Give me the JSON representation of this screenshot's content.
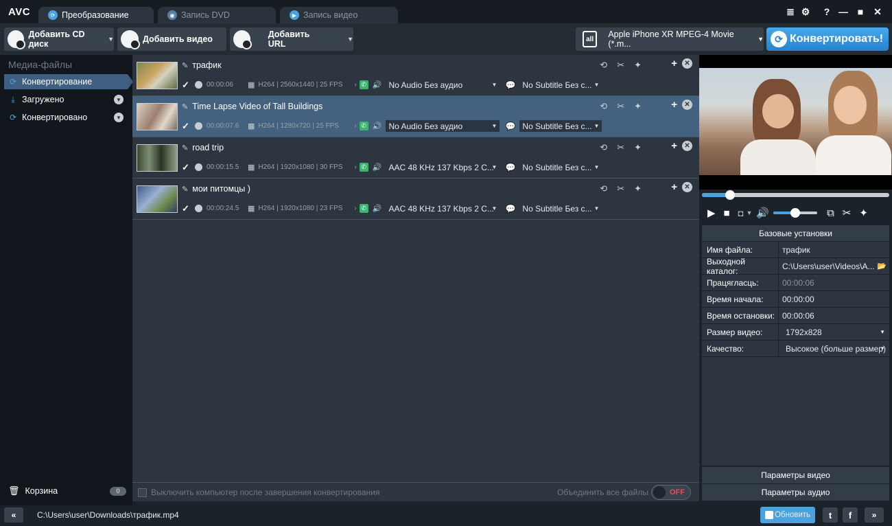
{
  "app": {
    "logo": "AVC"
  },
  "tabs": [
    {
      "label": "Преобразование",
      "icon": "convert-icon",
      "active": true
    },
    {
      "label": "Запись DVD",
      "icon": "dvd-icon",
      "active": false
    },
    {
      "label": "Запись видео",
      "icon": "record-icon",
      "active": false
    }
  ],
  "window_buttons": {
    "menu": "≣",
    "settings": "⚙",
    "help": "?",
    "minimize": "—",
    "maximize": "■",
    "close": "✕"
  },
  "toolbar": {
    "add_cd_label": "Добавить CD диск",
    "add_video_label": "Добавить видео",
    "add_url_label": "Добавить URL",
    "profile_label": "Apple iPhone XR MPEG-4 Movie (*.m...",
    "profile_icon_text": "all",
    "convert_label": "Конвертировать!",
    "accent": "#2f8fde"
  },
  "sidebar": {
    "title": "Медиа-файлы",
    "items": [
      {
        "label": "Конвертирование",
        "icon": "convert-icon",
        "active": true
      },
      {
        "label": "Загружено",
        "icon": "download-icon",
        "active": false
      },
      {
        "label": "Конвертировано",
        "icon": "converted-icon",
        "active": false
      }
    ],
    "trash_label": "Корзина",
    "trash_count": "0"
  },
  "files": [
    {
      "name": "трафик",
      "checked": true,
      "duration": "00:00:06",
      "codec": "H264 | 2560x1440 | 25 FPS",
      "audio": "No Audio Без аудио",
      "subtitle": "No Subtitle Без с...",
      "selected": false
    },
    {
      "name": "Time Lapse Video of Tall Buildings",
      "checked": true,
      "duration": "00:00:07.6",
      "codec": "H264 | 1280x720 | 25 FPS",
      "audio": "No Audio Без аудио",
      "subtitle": "No Subtitle Без с...",
      "selected": true
    },
    {
      "name": "road trip",
      "checked": true,
      "duration": "00:00:15.5",
      "codec": "H264 | 1920x1080 | 30 FPS",
      "audio": "AAC 48 KHz 137 Kbps 2 C...",
      "subtitle": "No Subtitle Без с...",
      "selected": false
    },
    {
      "name": "мои питомцы )",
      "checked": true,
      "duration": "00:00:24.5",
      "codec": "H264 | 1920x1080 | 23 FPS",
      "audio": "AAC 48 KHz 137 Kbps 2 C...",
      "subtitle": "No Subtitle Без с...",
      "selected": false
    }
  ],
  "list_footer": {
    "shutdown_label": "Выключить компьютер после завершения конвертирования",
    "merge_label": "Объединить все файлы",
    "merge_state": "OFF"
  },
  "player": {
    "seek_progress": 0.15,
    "volume": 0.5
  },
  "settings": {
    "title": "Базовые установки",
    "rows": [
      {
        "key": "Имя файла:",
        "value": "трафик",
        "dim": false,
        "widget": "text"
      },
      {
        "key": "Выходной каталог:",
        "value": "C:\\Users\\user\\Videos\\A...",
        "dim": false,
        "widget": "folder"
      },
      {
        "key": "Працягласць:",
        "value": "00:00:06",
        "dim": true,
        "widget": "text"
      },
      {
        "key": "Время начала:",
        "value": "00:00:00",
        "dim": false,
        "widget": "text"
      },
      {
        "key": "Время остановки:",
        "value": "00:00:06",
        "dim": false,
        "widget": "text"
      },
      {
        "key": "Размер видео:",
        "value": "1792x828",
        "dim": false,
        "widget": "dropdown"
      },
      {
        "key": "Качество:",
        "value": "Высокое (больше размер)",
        "dim": false,
        "widget": "dropdown"
      }
    ],
    "video_params_label": "Параметры видео",
    "audio_params_label": "Параметры аудио"
  },
  "statusbar": {
    "path": "C:\\Users\\user\\Downloads\\трафик.mp4",
    "update_label": "Обновить",
    "twitter": "t",
    "facebook": "f"
  }
}
